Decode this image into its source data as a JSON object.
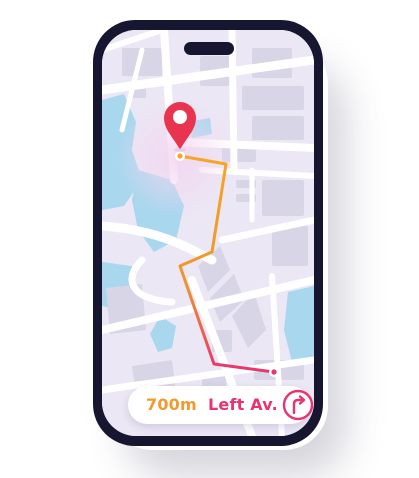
{
  "navigation": {
    "distance": "700m",
    "street": "Left Av.",
    "turn_icon": "turn-right-arrow-icon"
  },
  "map": {
    "pin_icon": "location-pin-icon",
    "route_colors": {
      "start": "#f6a623",
      "end": "#e8346f"
    },
    "pin_color": "#e8344e",
    "water_color": "#a8d7ee",
    "block_color": "#d7d4e6",
    "road_color": "#ffffff"
  }
}
